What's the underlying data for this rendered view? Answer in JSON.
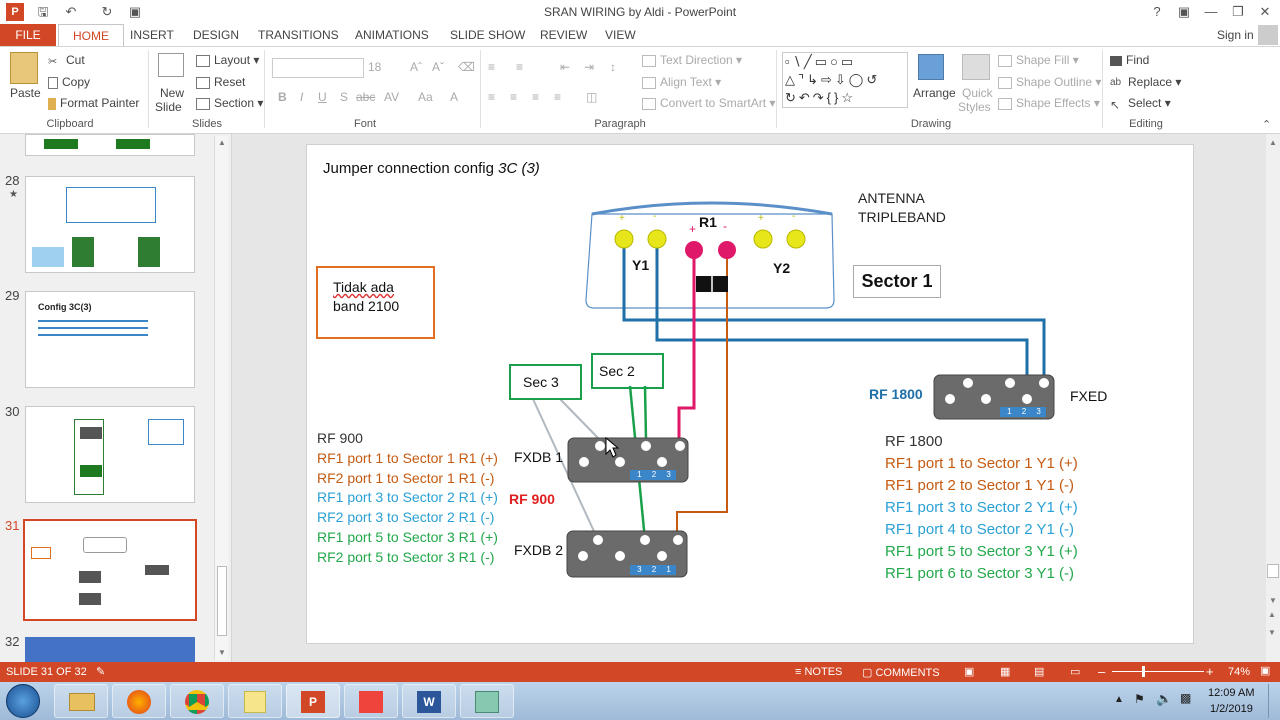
{
  "window": {
    "title": "SRAN WIRING by Aldi - PowerPoint",
    "sign_in": "Sign in"
  },
  "tabs": [
    "FILE",
    "HOME",
    "INSERT",
    "DESIGN",
    "TRANSITIONS",
    "ANIMATIONS",
    "SLIDE SHOW",
    "REVIEW",
    "VIEW"
  ],
  "ribbon": {
    "clipboard": {
      "paste": "Paste",
      "cut": "Cut",
      "copy": "Copy",
      "format_painter": "Format Painter",
      "label": "Clipboard"
    },
    "slides": {
      "new_slide_1": "New",
      "new_slide_2": "Slide",
      "layout": "Layout",
      "reset": "Reset",
      "section": "Section",
      "label": "Slides"
    },
    "font": {
      "size": "18",
      "bold": "B",
      "italic": "I",
      "underline": "U",
      "shadow": "S",
      "strike": "abc",
      "spacing": "AV",
      "case": "Aa",
      "color": "A",
      "label": "Font"
    },
    "paragraph": {
      "text_direction": "Text Direction",
      "align_text": "Align Text",
      "smartart": "Convert to SmartArt",
      "label": "Paragraph"
    },
    "drawing": {
      "arrange": "Arrange",
      "quick_1": "Quick",
      "quick_2": "Styles",
      "shape_fill": "Shape Fill",
      "shape_outline": "Shape Outline",
      "shape_effects": "Shape Effects",
      "label": "Drawing"
    },
    "editing": {
      "find": "Find",
      "replace": "Replace",
      "select": "Select",
      "label": "Editing"
    }
  },
  "thumbs": [
    {
      "num": "28",
      "star": "★"
    },
    {
      "num": "29",
      "title": "Config 3C(3)"
    },
    {
      "num": "30"
    },
    {
      "num": "31"
    },
    {
      "num": "32"
    }
  ],
  "slide": {
    "title_a": "Jumper connection config ",
    "title_b": "3C (3)",
    "antenna_1": "ANTENNA",
    "antenna_2": "TRIPLEBAND",
    "r1": "R1",
    "y1": "Y1",
    "y2": "Y2",
    "plus": "+",
    "minus": "-",
    "sector1": "Sector 1",
    "note_1": "Tidak ada",
    "note_2": "band 2100",
    "sec3": "Sec 3",
    "sec2": "Sec 2",
    "fxdb1": "FXDB 1",
    "fxdb2": "FXDB 2",
    "fxed": "FXED",
    "rf1800_label": "RF 1800",
    "rf900_red": "RF 900",
    "ports_a": [
      "1",
      "2",
      "3"
    ],
    "ports_b": [
      "3",
      "2",
      "1"
    ],
    "rf900_list": {
      "title": "RF 900",
      "items": [
        {
          "text": "RF1 port 1 to Sector 1 R1 (+)",
          "color": "#c55a11"
        },
        {
          "text": "RF2 port 1 to Sector 1 R1 (-)",
          "color": "#c55a11"
        },
        {
          "text": "RF1 port 3 to Sector 2 R1 (+)",
          "color": "#2aa0d4"
        },
        {
          "text": "RF2 port 3 to Sector 2 R1 (-)",
          "color": "#2aa0d4"
        },
        {
          "text": "RF1 port 5 to Sector 3 R1 (+)",
          "color": "#22a84a"
        },
        {
          "text": "RF2 port 5 to Sector 3 R1 (-)",
          "color": "#22a84a"
        }
      ]
    },
    "rf1800_list": {
      "title": "RF 1800",
      "items": [
        {
          "text": "RF1 port 1 to Sector 1 Y1 (+)",
          "color": "#c55a11"
        },
        {
          "text": "RF1 port 2 to Sector 1 Y1 (-)",
          "color": "#c55a11"
        },
        {
          "text": "RF1 port 3 to Sector 2 Y1 (+)",
          "color": "#2aa0d4"
        },
        {
          "text": "RF1 port 4 to Sector 2 Y1 (-)",
          "color": "#2aa0d4"
        },
        {
          "text": "RF1 port 5 to Sector 3 Y1 (+)",
          "color": "#22a84a"
        },
        {
          "text": "RF1 port 6 to Sector 3 Y1 (-)",
          "color": "#22a84a"
        }
      ]
    }
  },
  "status": {
    "slide_info": "SLIDE 31 OF 32",
    "notes": "NOTES",
    "comments": "COMMENTS",
    "zoom": "74%"
  },
  "taskbar": {
    "time": "12:09 AM",
    "date": "1/2/2019"
  }
}
